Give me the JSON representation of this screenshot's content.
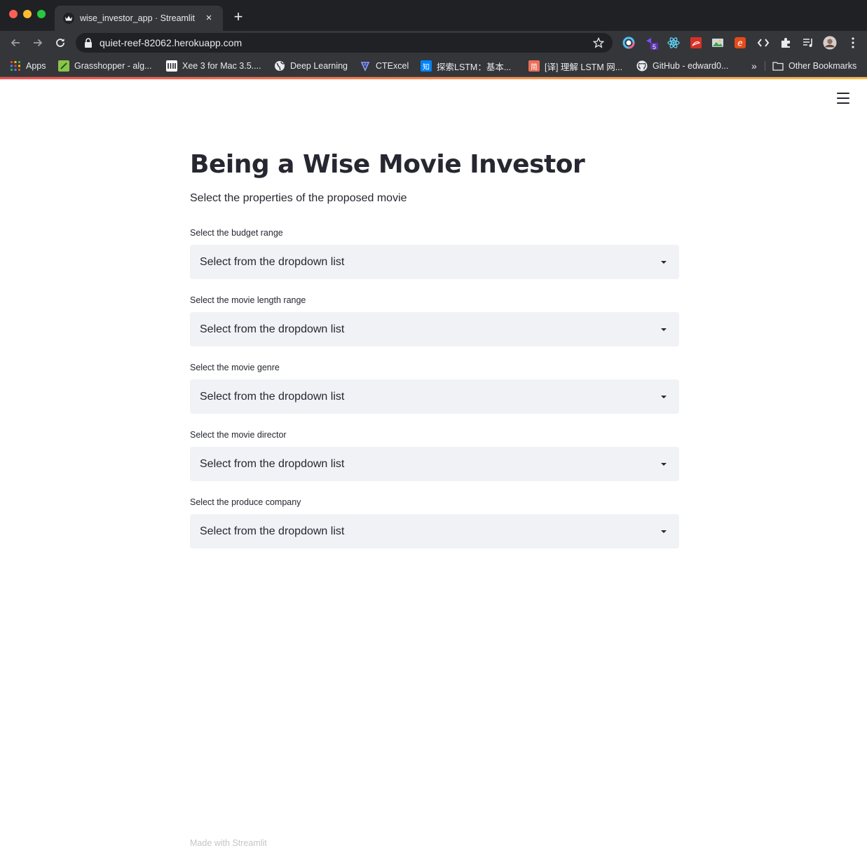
{
  "browser": {
    "tab_title": "wise_investor_app · Streamlit",
    "tab_close": "×",
    "new_tab": "+",
    "url": "quiet-reef-82062.herokuapp.com",
    "extension_badge": "5",
    "bookmarks": [
      {
        "label": "Apps"
      },
      {
        "label": "Grasshopper - alg..."
      },
      {
        "label": "Xee 3 for Mac 3.5...."
      },
      {
        "label": "Deep Learning"
      },
      {
        "label": "CTExcel"
      },
      {
        "label": "探索LSTM：基本..."
      },
      {
        "label": "[译] 理解 LSTM 网..."
      },
      {
        "label": "GitHub - edward0..."
      }
    ],
    "bookmarks_overflow": "»",
    "other_bookmarks": "Other Bookmarks"
  },
  "app": {
    "title": "Being a Wise Movie Investor",
    "subtitle": "Select the properties of the proposed movie",
    "fields": [
      {
        "label": "Select the budget range",
        "value": "Select from the dropdown list"
      },
      {
        "label": "Select the movie length range",
        "value": "Select from the dropdown list"
      },
      {
        "label": "Select the movie genre",
        "value": "Select from the dropdown list"
      },
      {
        "label": "Select the movie director",
        "value": "Select from the dropdown list"
      },
      {
        "label": "Select the produce company",
        "value": "Select from the dropdown list"
      }
    ],
    "footer": "Made with Streamlit"
  },
  "colors": {
    "accent_gradient_start": "#ff4b4b",
    "accent_gradient_end": "#ffbd45",
    "select_background": "#f0f2f6",
    "text": "#262730"
  }
}
